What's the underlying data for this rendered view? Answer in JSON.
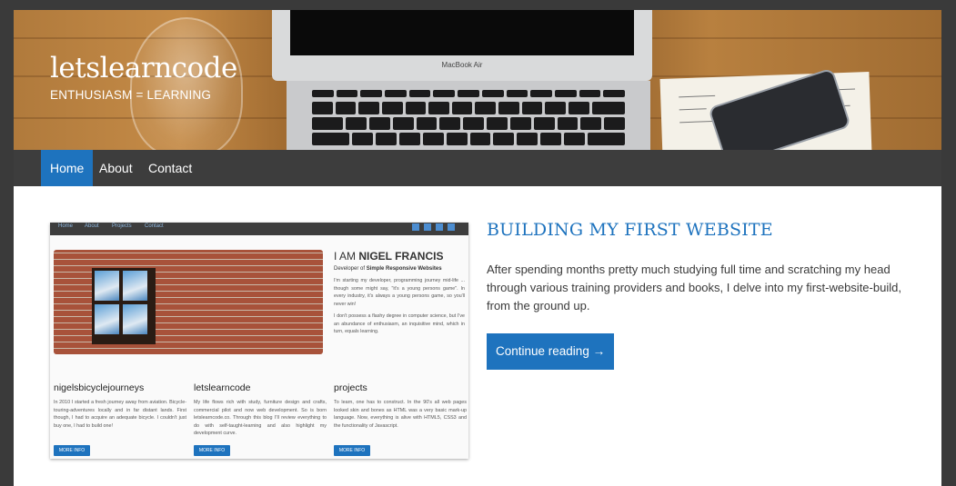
{
  "site": {
    "title": "letslearncode",
    "tagline": "ENTHUSIASM = LEARNING",
    "laptop_brand": "MacBook Air"
  },
  "nav": {
    "items": [
      {
        "label": "Home",
        "active": true
      },
      {
        "label": "About",
        "active": false
      },
      {
        "label": "Contact",
        "active": false
      }
    ]
  },
  "post": {
    "title": "BUILDING MY FIRST WEBSITE",
    "excerpt": "After spending months pretty much studying full time and scratching my head through various training providers and books, I delve into my first-website-build, from the ground up.",
    "read_more": "Continue reading →"
  },
  "thumbnail": {
    "nav": [
      "Home",
      "About",
      "Projects",
      "Contact"
    ],
    "intro_prefix": "I AM ",
    "intro_name": "NIGEL FRANCIS",
    "intro_sub_prefix": "Developer of ",
    "intro_sub_bold": "Simple Responsive Websites",
    "intro_body_1": "I'm starting my developer, programming journey mid-life ... though some might say, \"it's a young persons game\". In every industry, it's always a young persons game, so you'll never win!",
    "intro_body_2": "I don't possess a flashy degree in computer science, but I've an abundance of enthusiasm, an inquisitive mind, which in turn, equals learning.",
    "columns": [
      {
        "heading": "nigelsbicyclejourneys",
        "body": "In 2010 I started a fresh journey away from aviation. Bicycle-touring-adventures locally and in far distant lands. First though, I had to acquire an adequate bicycle. I couldn't just buy one, I had to build one!",
        "button": "MORE INFO"
      },
      {
        "heading": "letslearncode",
        "body": "My life flows rich with study, furniture design and crafts, commercial pilot and now web development. So is born letslearncode.co. Through this blog I'll review everything to do with self-taught-learning and also highlight my development curve.",
        "button": "MORE INFO"
      },
      {
        "heading": "projects",
        "body": "To learn, one has to construct. In the 90's all web pages looked skin and bones as HTML was a very basic mark-up language. Now, everything is alive with HTML5, CSS3 and the functionality of Javascript.",
        "button": "MORE INFO"
      }
    ]
  },
  "colors": {
    "accent": "#1e73be",
    "nav_bg": "#3d3d3d",
    "page_bg": "#3a3a3a"
  }
}
